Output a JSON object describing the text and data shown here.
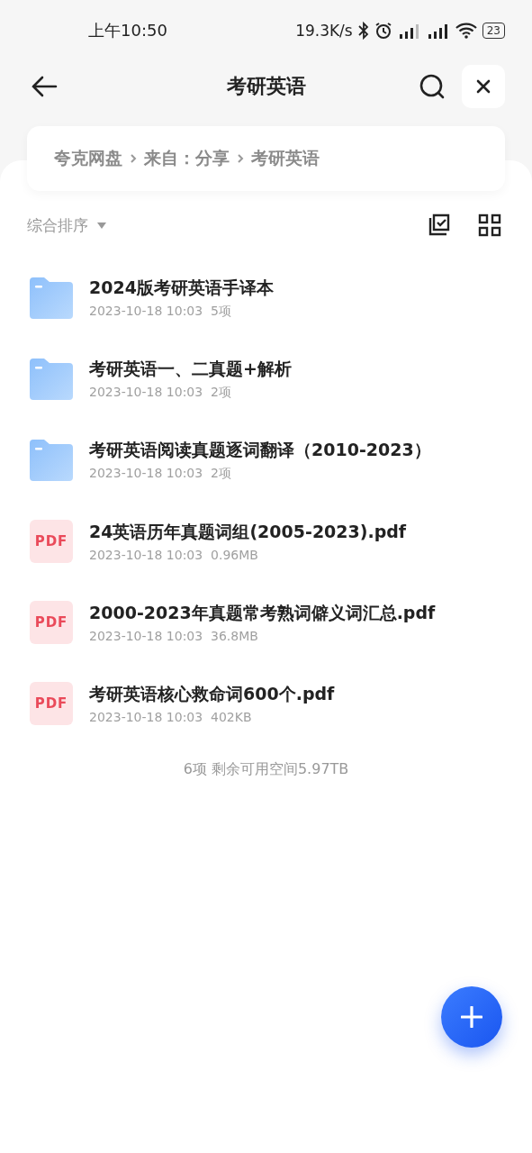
{
  "status_bar": {
    "time": "上午10:50",
    "speed": "19.3K/s",
    "battery": "23"
  },
  "header": {
    "title": "考研英语"
  },
  "breadcrumb": [
    "夸克网盘",
    "来自：分享",
    "考研英语"
  ],
  "sort": {
    "label": "综合排序"
  },
  "files": [
    {
      "kind": "folder",
      "name": "2024版考研英语手译本",
      "date": "2023-10-18 10:03",
      "info": "5项"
    },
    {
      "kind": "folder",
      "name": "考研英语一、二真题+解析",
      "date": "2023-10-18 10:03",
      "info": "2项"
    },
    {
      "kind": "folder",
      "name": "考研英语阅读真题逐词翻译（2010-2023）",
      "date": "2023-10-18 10:03",
      "info": "2项"
    },
    {
      "kind": "pdf",
      "badge": "PDF",
      "name": "24英语历年真题词组(2005-2023).pdf",
      "date": "2023-10-18 10:03",
      "info": "0.96MB"
    },
    {
      "kind": "pdf",
      "badge": "PDF",
      "name": "2000-2023年真题常考熟词僻义词汇总.pdf",
      "date": "2023-10-18 10:03",
      "info": "36.8MB"
    },
    {
      "kind": "pdf",
      "badge": "PDF",
      "name": "考研英语核心救命词600个.pdf",
      "date": "2023-10-18 10:03",
      "info": "402KB"
    }
  ],
  "footer": "6项 剩余可用空间5.97TB"
}
